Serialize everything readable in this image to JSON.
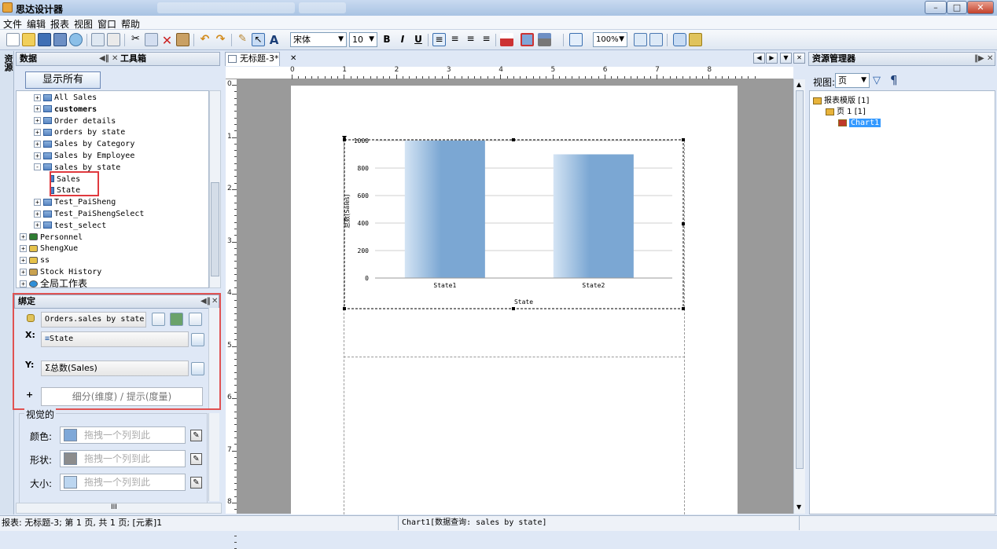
{
  "window": {
    "title": "思达设计器"
  },
  "menu": [
    "文件",
    "编辑",
    "报表",
    "视图",
    "窗口",
    "帮助"
  ],
  "toolbar": {
    "font_name": "宋体",
    "font_size": "10",
    "zoom": "100%",
    "bold": "B",
    "italic": "I",
    "underline": "U"
  },
  "left_panel": {
    "strip_label": "资源",
    "tabs": [
      "数据",
      "工具箱"
    ],
    "show_all_button": "显示所有",
    "tree": [
      {
        "label": "All Sales",
        "level": 2,
        "icon": "table",
        "expander": "+"
      },
      {
        "label": "customers",
        "level": 2,
        "icon": "table",
        "expander": "+",
        "bold": true
      },
      {
        "label": "Order details",
        "level": 2,
        "icon": "table",
        "expander": "+"
      },
      {
        "label": "orders by state",
        "level": 2,
        "icon": "table",
        "expander": "+"
      },
      {
        "label": "Sales by Category",
        "level": 2,
        "icon": "table",
        "expander": "+"
      },
      {
        "label": "Sales by Employee",
        "level": 2,
        "icon": "table",
        "expander": "+"
      },
      {
        "label": "sales by state",
        "level": 2,
        "icon": "table",
        "expander": "-"
      },
      {
        "label": "Sales",
        "level": 3,
        "icon": "field",
        "expander": ""
      },
      {
        "label": "State",
        "level": 3,
        "icon": "field",
        "expander": ""
      },
      {
        "label": "Test_PaiSheng",
        "level": 2,
        "icon": "table",
        "expander": "+"
      },
      {
        "label": "Test_PaiShengSelect",
        "level": 2,
        "icon": "table",
        "expander": "+"
      },
      {
        "label": "test_select",
        "level": 2,
        "icon": "table",
        "expander": "+"
      },
      {
        "label": "Personnel",
        "level": 1,
        "icon": "excel",
        "expander": "+"
      },
      {
        "label": "ShengXue",
        "level": 1,
        "icon": "database",
        "expander": "+"
      },
      {
        "label": "ss",
        "level": 1,
        "icon": "database",
        "expander": "+"
      },
      {
        "label": "Stock History",
        "level": 1,
        "icon": "folder",
        "expander": "+"
      },
      {
        "label": "全局工作表",
        "level": 1,
        "icon": "globe",
        "expander": "+"
      }
    ]
  },
  "binding": {
    "title": "绑定",
    "source": "Orders.sales by state",
    "x_label": "X:",
    "x_field": "State",
    "y_label": "Y:",
    "y_field": "总数(Sales)",
    "plus": "+",
    "drop_hint": "细分(维度) / 提示(度量)"
  },
  "visual": {
    "title": "视觉的",
    "rows": [
      {
        "label": "颜色:",
        "hint": "拖拽一个列到此",
        "swatch": "#7fa8d8"
      },
      {
        "label": "形状:",
        "hint": "拖拽一个列到此",
        "swatch": "#8c8c8c"
      },
      {
        "label": "大小:",
        "hint": "拖拽一个列到此",
        "swatch": "#bcd6f0"
      }
    ],
    "scroll_arrow": "III"
  },
  "document": {
    "tab": "无标题-3*"
  },
  "chart_data": {
    "type": "bar",
    "categories": [
      "State1",
      "State2"
    ],
    "values": [
      1000,
      900
    ],
    "xlabel": "State",
    "ylabel": "总数(Sales)",
    "ylim": [
      0,
      1000
    ],
    "yticks": [
      "0",
      "200",
      "400",
      "600",
      "800",
      "1000"
    ],
    "color": "#7ba7d3",
    "grid": true
  },
  "right_panel": {
    "title": "资源管理器",
    "view_label": "视图:",
    "view_value": "页",
    "tree": [
      {
        "label": "报表模版 [1]",
        "level": 0
      },
      {
        "label": "页 1  [1]",
        "level": 1
      },
      {
        "label": "Chart1",
        "level": 2,
        "selected": true
      }
    ]
  },
  "status": {
    "left": "报表: 无标题-3; 第 1 页, 共 1 页; [元素]1",
    "center": "Chart1[数据查询: sales by state]"
  }
}
